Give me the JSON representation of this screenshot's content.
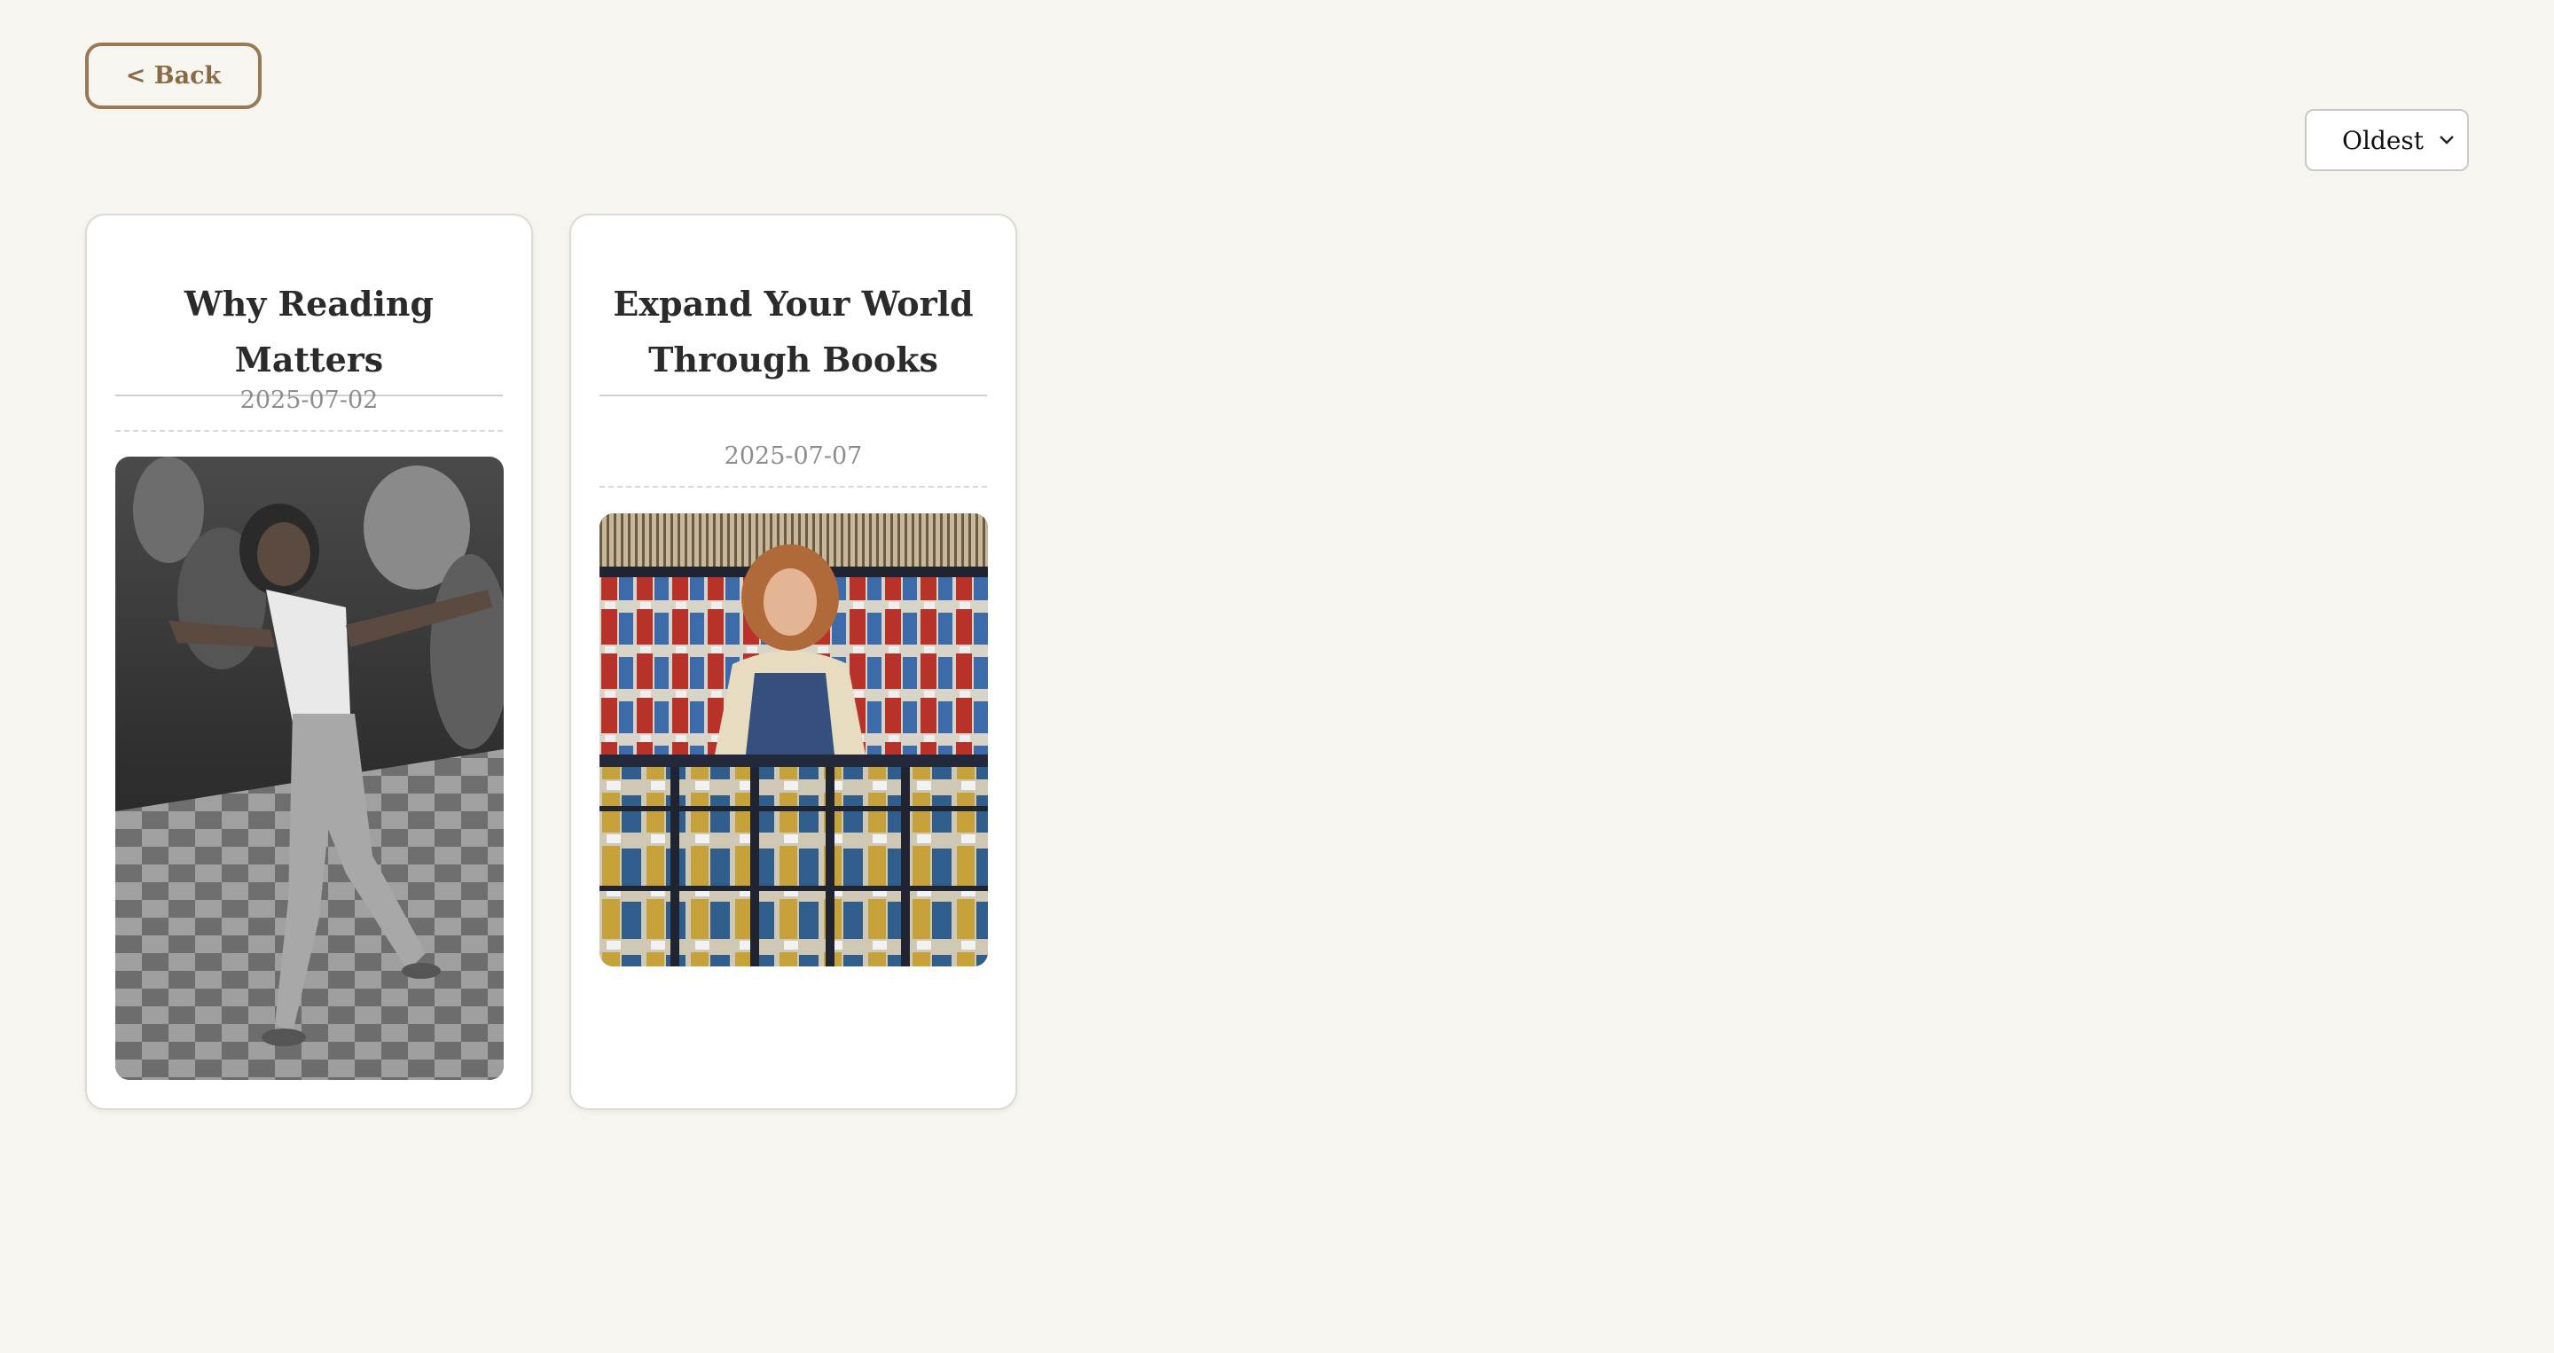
{
  "nav": {
    "back_label": "< Back"
  },
  "sort": {
    "selected": "Oldest"
  },
  "posts": [
    {
      "title": "Why Reading Matters",
      "date": "2025-07-02",
      "image_icon": "dancing-woman-photo"
    },
    {
      "title": "Expand Your World Through Books",
      "date": "2025-07-07",
      "image_icon": "record-store-photo"
    }
  ],
  "colors": {
    "background": "#f6f5f0",
    "accent": "#9a7a55",
    "card_bg": "#ffffff",
    "title_text": "#2b2b2b",
    "date_text": "#8d8d8d"
  }
}
